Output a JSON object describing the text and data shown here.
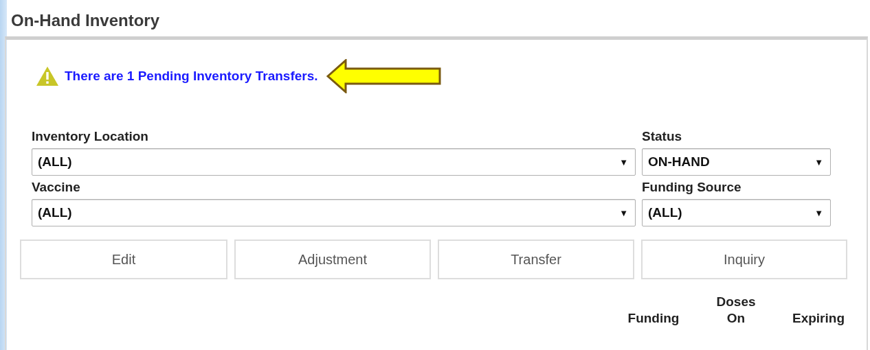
{
  "page_title": "On-Hand Inventory",
  "alert": {
    "text": "There are 1 Pending Inventory Transfers."
  },
  "filters": [
    {
      "label": "Inventory Location",
      "value": "(ALL)",
      "kind": "wide"
    },
    {
      "label": "Status",
      "value": "ON-HAND",
      "kind": "narrow"
    },
    {
      "label": "Vaccine",
      "value": "(ALL)",
      "kind": "wide"
    },
    {
      "label": "Funding Source",
      "value": "(ALL)",
      "kind": "narrow"
    }
  ],
  "dropdown_caret": "▼",
  "buttons": [
    "Edit",
    "Adjustment",
    "Transfer",
    "Inquiry"
  ],
  "table": {
    "group_header": "Doses",
    "columns": [
      "Funding",
      "On",
      "Expiring"
    ]
  }
}
